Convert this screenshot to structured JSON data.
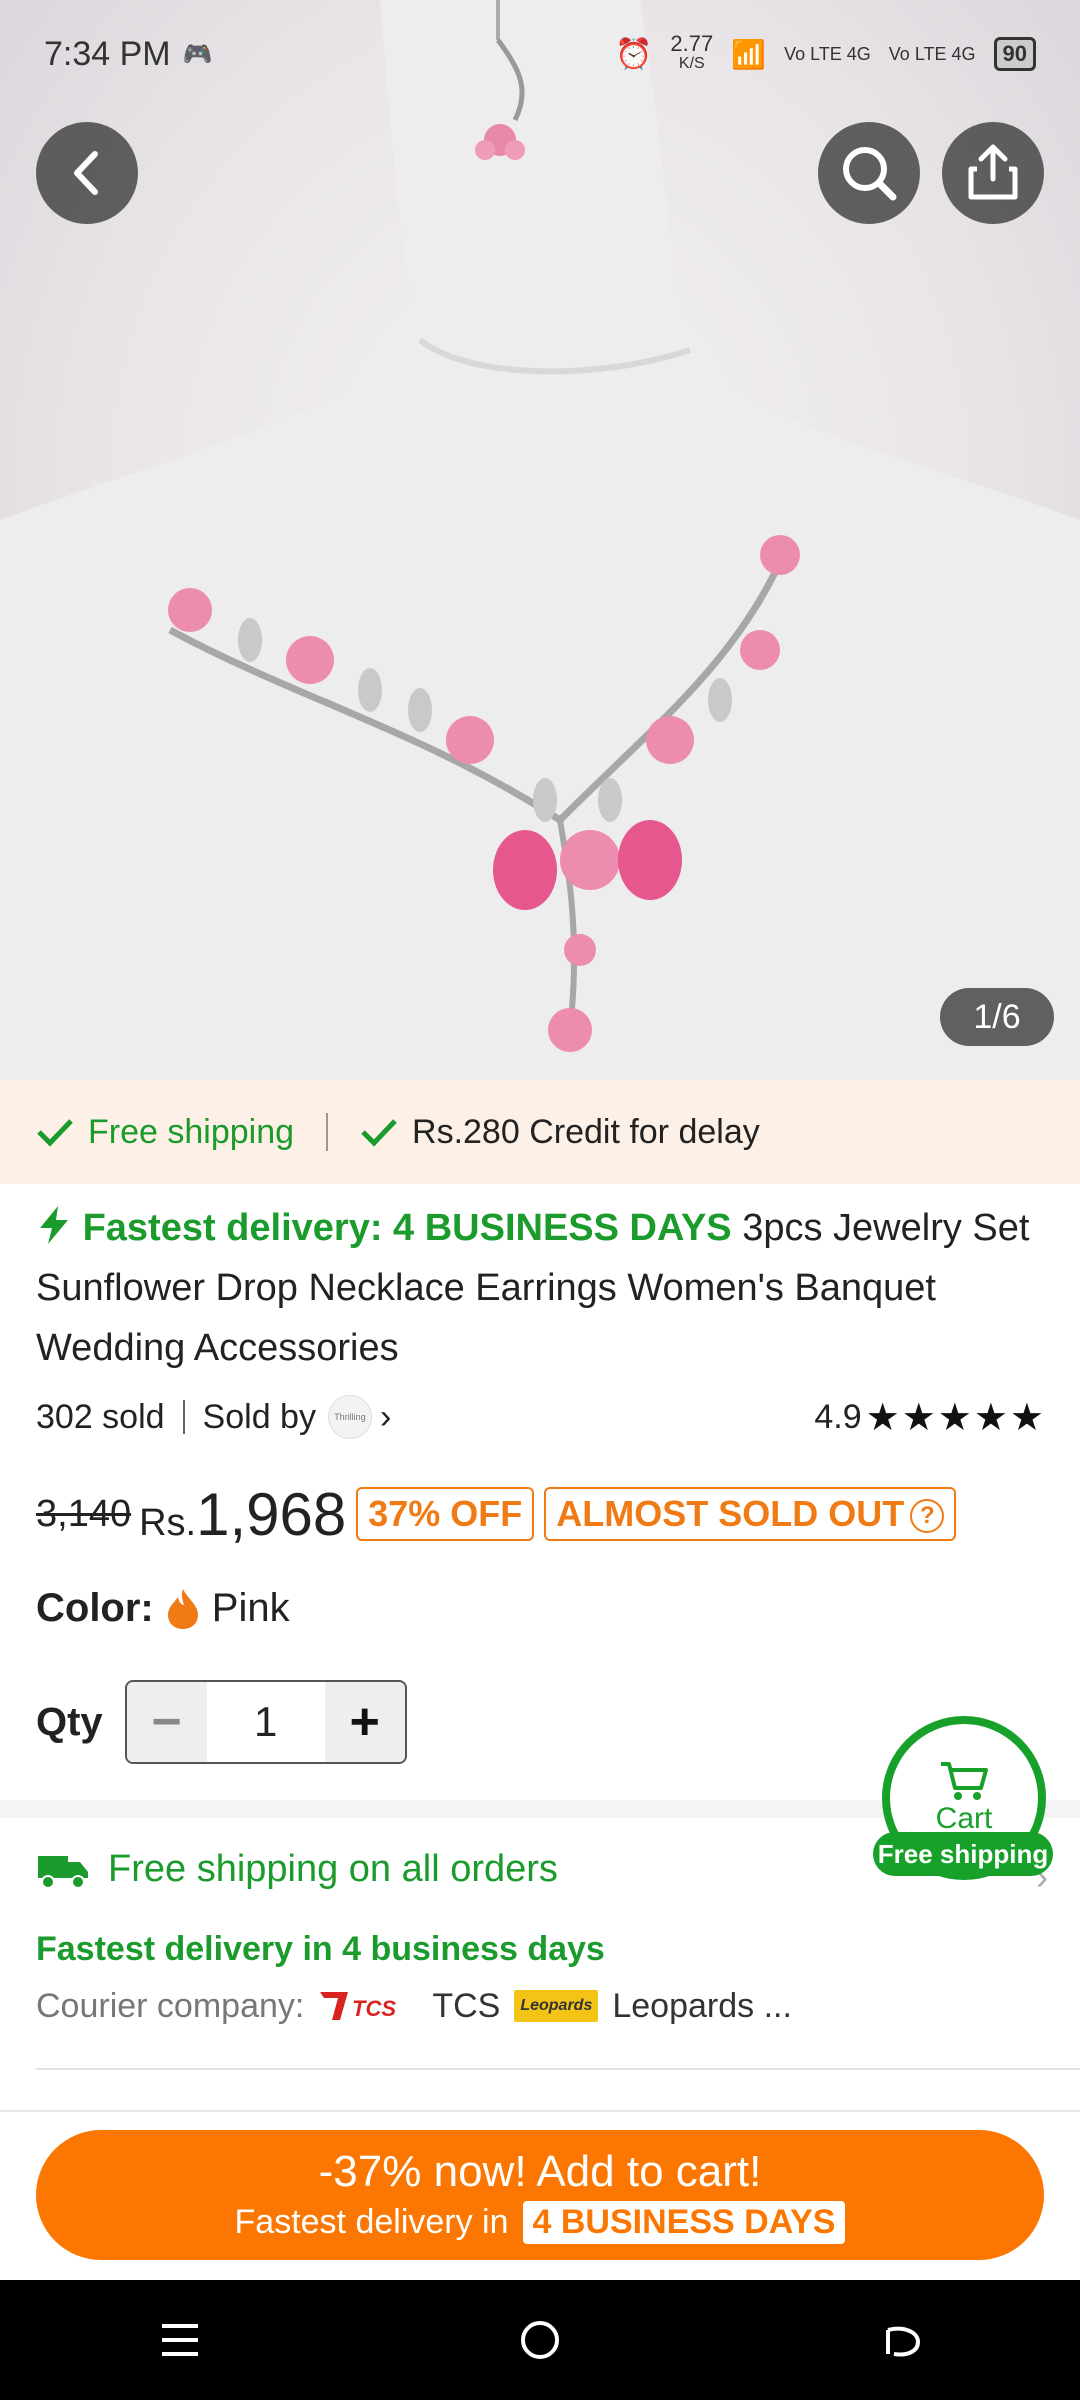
{
  "status_bar": {
    "time": "7:34 PM",
    "net_speed": "2.77",
    "net_unit": "K/S",
    "sim1": "Vo LTE 4G",
    "sim2": "Vo LTE 4G",
    "battery": "90"
  },
  "hero": {
    "image_counter": "1/6"
  },
  "shipping_strip": {
    "free_shipping": "Free shipping",
    "credit": "Rs.280 Credit for delay"
  },
  "product": {
    "fast_delivery": "Fastest delivery: 4 BUSINESS DAYS",
    "title": "3pcs Jewelry Set Sunflower Drop Necklace Earrings Women's Banquet Wedding Accessories",
    "sold": "302 sold",
    "sold_by": "Sold by",
    "seller_logo_text": "Thrilling",
    "rating": "4.9",
    "stars": "★★★★★"
  },
  "price": {
    "original": "3,140",
    "currency": "Rs.",
    "current": "1,968",
    "discount": "37% OFF",
    "almost": "ALMOST SOLD OUT",
    "help": "?"
  },
  "options": {
    "color_label": "Color:",
    "color_value": "Pink",
    "qty_label": "Qty",
    "qty_value": "1",
    "minus": "−",
    "plus": "+"
  },
  "cart_float": {
    "label": "Cart",
    "badge": "Free shipping"
  },
  "shipping_info": {
    "headline": "Free shipping on all orders",
    "fastest": "Fastest delivery in 4 business days",
    "courier_label": "Courier company:",
    "courier1": "TCS",
    "courier2_logo": "Leopards",
    "courier2": "Leopards ..."
  },
  "cta": {
    "line1": "-37% now! Add to cart!",
    "line2": "Fastest delivery in",
    "pill": "4 BUSINESS DAYS"
  },
  "colors": {
    "green": "#1a9b2c",
    "orange": "#fb7701",
    "strip_bg": "#fdf0e6"
  }
}
